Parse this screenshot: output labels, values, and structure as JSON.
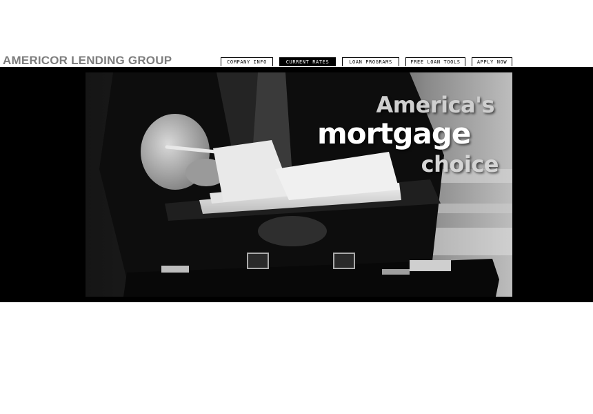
{
  "header": {
    "brand": "AMERICOR LENDING GROUP"
  },
  "nav": {
    "tabs": [
      {
        "label": "COMPANY INFO",
        "active": false
      },
      {
        "label": "CURRENT RATES",
        "active": true
      },
      {
        "label": "LOAN PROGRAMS",
        "active": false
      },
      {
        "label": "FREE LOAN TOOLS",
        "active": false
      },
      {
        "label": "APPLY NOW",
        "active": false
      }
    ]
  },
  "hero": {
    "tagline_1": "America's",
    "tagline_2": "mortgage",
    "tagline_3": "choice",
    "photo_subject": "businessman-with-notebook-pen-and-briefcase"
  },
  "colors": {
    "brand_text": "#7d7d7d",
    "band": "#000000",
    "active_tab": "#000000"
  }
}
